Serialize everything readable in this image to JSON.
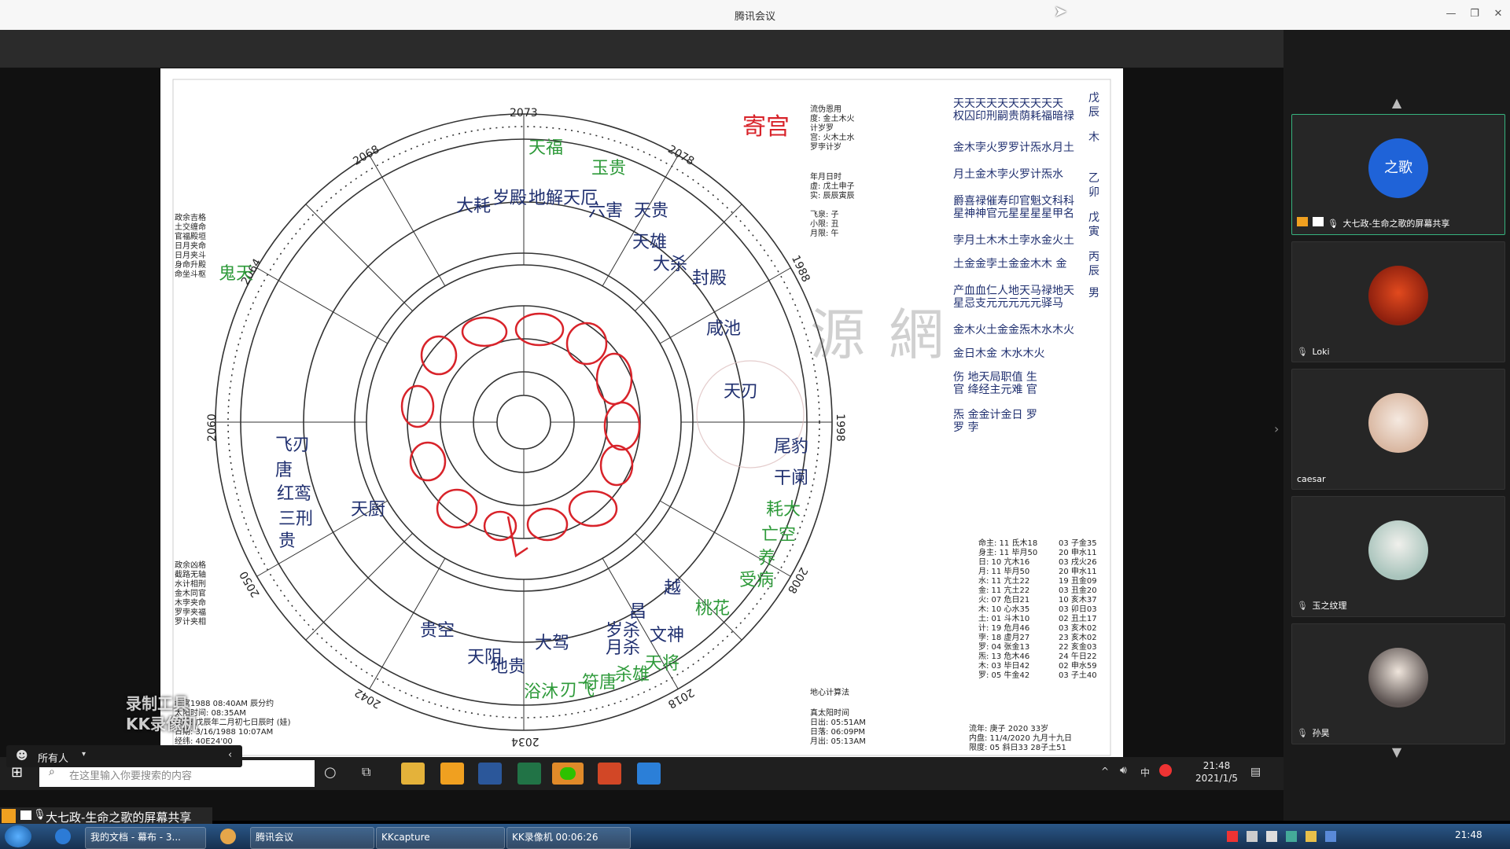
{
  "window": {
    "title": "腾讯会议"
  },
  "chart": {
    "title": "寄宫",
    "years": [
      "2073",
      "2078",
      "1988",
      "1998",
      "2008",
      "2018",
      "2034",
      "2042",
      "2050",
      "2060",
      "2064",
      "2068"
    ],
    "ring_gods": [
      "天福",
      "地解",
      "天厄",
      "六害",
      "玉贵",
      "大耗",
      "岁殿",
      "天贵",
      "天雄",
      "大杀",
      "封殿",
      "咸池",
      "天刃",
      "尾豹",
      "干阑",
      "耗大",
      "亡空",
      "养",
      "受病",
      "桃花",
      "岁杀",
      "月杀",
      "贵空",
      "天阴",
      "地贵",
      "大驾",
      "浴沐",
      "刃飞",
      "符唐",
      "杀雄",
      "天将",
      "昌",
      "文神",
      "越",
      "鬼天",
      "天厨",
      "飞刃",
      "唐",
      "红鸾",
      "三刑",
      "贵"
    ],
    "watermark": "源網",
    "left_notes_top": [
      "政余吉格",
      "土交缠命",
      "官福殿垣",
      "日月夹命",
      "日月夹斗",
      "身命升殿",
      "命坐斗枢"
    ],
    "left_notes_bottom": [
      "政余凶格",
      "截路无轴",
      "水计相刑",
      "金木同官",
      "木孛夹命",
      "罗孛夹福",
      "罗计夹相"
    ],
    "right_top_notes": [
      "流伪恩用",
      "度: 金土木火",
      "计岁罗",
      "宫: 火木土水",
      "罗孛计岁"
    ],
    "right_mid_notes": [
      "年月日时",
      "虚: 戊土申子",
      "实: 辰辰寅辰",
      "飞泉: 子",
      "小限: 丑",
      "月限: 午"
    ],
    "right_col_lines": [
      "天天天天天天天天天天",
      "权囚印刑嗣贵荫耗福暗禄",
      "金木孛火罗罗计炁水月土",
      "月土金木孛火罗计炁水",
      "爵喜禄催寿印官魁文科科",
      "星神神官元星星星星甲名",
      "孛月土木木土孛水金火土",
      "土金金孛土金金木木 金",
      "产血血仁人地天马禄地天",
      "星忌支元元元元元驿马",
      "金木火土金金炁木水木火",
      "金日木金 木水木火",
      "伤 地天局职值 生",
      "官 绛经主元难 官",
      "炁 金金计金日 罗",
      "罗 孛"
    ],
    "right_labels": [
      "戊辰",
      "木",
      "乙卯",
      "戊寅",
      "丙辰",
      "男"
    ],
    "planets": [
      "命主: 11 氐木18",
      "身主: 11 毕月50",
      "日: 10 亢木16",
      "月: 11 毕月50",
      "水: 11 亢土22",
      "金: 11 亢土22",
      "火: 07 危日21",
      "木: 10 心水35",
      "土: 01 斗木10",
      "计: 19 危月46",
      "孛: 18 虚月27",
      "罗: 04 张金13",
      "炁: 13 危木46",
      "木: 03 毕日42",
      "罗: 05 牛金42"
    ],
    "planets_right": [
      "03 子金35",
      "20 申水11",
      "03 戌火26",
      "20 申水11",
      "19 丑金09",
      "03 丑金20",
      "10 亥木37",
      "03 卯日03",
      "02 丑土17",
      "03 亥木02",
      "23 亥木02",
      "22 亥金03",
      "24 午日22",
      "02 申水59",
      "03 子土40"
    ],
    "bottom_left": [
      "命宫1988 08:40AM 辰分约",
      "太阳时间: 08:35AM",
      "农历: 戊辰年二月初七日辰时 (娃)",
      "日期: 3/16/1988 10:07AM",
      "经纬: 40E24'00"
    ],
    "bottom_mid": [
      "地心计算法",
      "真太阳时间",
      "日出: 05:51AM",
      "日落: 06:09PM",
      "月出: 05:13AM"
    ],
    "bottom_right": [
      "流年: 庚子 2020 33岁",
      "内盘: 11/4/2020 九月十九日",
      "限度: 05 斜日33 28子土51"
    ]
  },
  "inner_taskbar": {
    "search_placeholder": "在这里输入你要搜索的内容",
    "time": "21:48",
    "date": "2021/1/5",
    "ime": "中"
  },
  "chat_bar": {
    "label": "所有人"
  },
  "share_label": "大七政-生命之歌的屏幕共享",
  "participants": [
    {
      "name": "大七政-生命之歌的屏幕共享",
      "avatar_text": "之歌",
      "color": "#1f63d8"
    },
    {
      "name": "Loki",
      "avatar_text": "",
      "color": "#c83a1c"
    },
    {
      "name": "caesar",
      "avatar_text": "",
      "color": "#e6c9b7"
    },
    {
      "name": "玉之纹理",
      "avatar_text": "",
      "color": "#b7c9c2"
    },
    {
      "name": "孙昊",
      "avatar_text": "",
      "color": "#7a6f6a"
    }
  ],
  "outer_taskbar": {
    "tasks": [
      "我的文档 - 幕布 - 3...",
      "腾讯会议",
      "KKcapture",
      "KK录像机 00:06:26"
    ],
    "clock": "21:48"
  },
  "watermark_overlay": {
    "line1": "录制工具",
    "line2": "KK录像机"
  }
}
